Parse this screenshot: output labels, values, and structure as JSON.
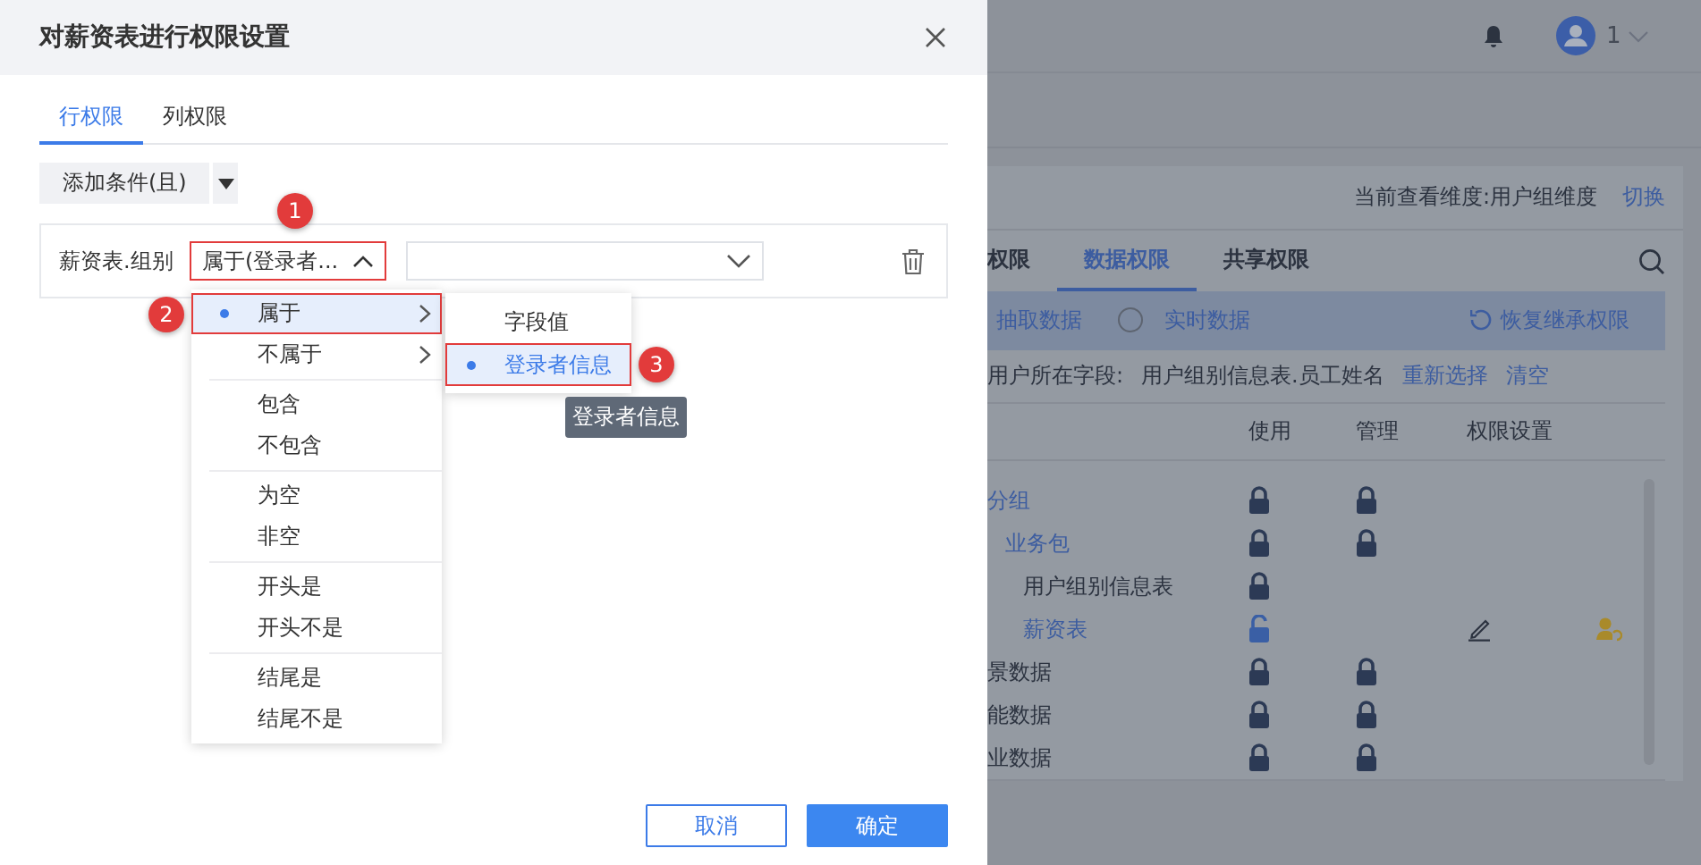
{
  "dialog": {
    "title": "对薪资表进行权限设置",
    "tabs": [
      {
        "label": "行权限",
        "selected": true
      },
      {
        "label": "列权限",
        "selected": false
      }
    ],
    "add_condition_button": "添加条件(且)",
    "condition": {
      "field": "薪资表.组别",
      "operator": "属于(登录者...",
      "operator_open": true
    },
    "operator_menu": [
      [
        {
          "label": "属于",
          "selected": true,
          "submenu": true
        },
        {
          "label": "不属于",
          "selected": false,
          "submenu": true
        }
      ],
      [
        {
          "label": "包含",
          "selected": false,
          "submenu": false
        },
        {
          "label": "不包含",
          "selected": false,
          "submenu": false
        }
      ],
      [
        {
          "label": "为空",
          "selected": false,
          "submenu": false
        },
        {
          "label": "非空",
          "selected": false,
          "submenu": false
        }
      ],
      [
        {
          "label": "开头是",
          "selected": false,
          "submenu": false
        },
        {
          "label": "开头不是",
          "selected": false,
          "submenu": false
        }
      ],
      [
        {
          "label": "结尾是",
          "selected": false,
          "submenu": false
        },
        {
          "label": "结尾不是",
          "selected": false,
          "submenu": false
        }
      ]
    ],
    "submenu": [
      {
        "label": "字段值",
        "selected": false
      },
      {
        "label": "登录者信息",
        "selected": true
      }
    ],
    "tooltip": "登录者信息",
    "callouts": [
      "1",
      "2",
      "3"
    ],
    "buttons": [
      {
        "label": "取消",
        "kind": "secondary"
      },
      {
        "label": "确定",
        "kind": "primary"
      }
    ]
  },
  "background": {
    "user": "1",
    "dimension": "当前查看维度:用户组维度",
    "switch_link": "切换",
    "tabs": [
      {
        "label": "权限",
        "selected": false
      },
      {
        "label": "数据权限",
        "selected": true
      },
      {
        "label": "共享权限",
        "selected": false
      }
    ],
    "modes": [
      {
        "label": "抽取数据"
      },
      {
        "label": "实时数据",
        "selected": false
      }
    ],
    "restore": "恢复继承权限",
    "field_label": "用户所在字段:",
    "field_value": "用户组别信息表.员工姓名",
    "reselect": "重新选择",
    "clear": "清空",
    "columns": [
      "使用",
      "管理",
      "权限设置"
    ],
    "rows": [
      {
        "name": "分组",
        "link": true,
        "use_locked": true,
        "manage_lock": true,
        "children": [
          {
            "name": "业务包",
            "link": true,
            "use_locked": true,
            "manage_lock": true,
            "children": [
              {
                "name": "用户组别信息表",
                "link": false,
                "use_locked": true,
                "manage_lock": false
              },
              {
                "name": "薪资表",
                "link": true,
                "use_locked": false,
                "manage_lock": false,
                "settings": true
              }
            ]
          }
        ]
      },
      {
        "name": "景数据",
        "link": false,
        "use_locked": true,
        "manage_lock": true
      },
      {
        "name": "能数据",
        "link": false,
        "use_locked": true,
        "manage_lock": true
      },
      {
        "name": "业数据",
        "link": false,
        "use_locked": true,
        "manage_lock": true
      }
    ]
  }
}
